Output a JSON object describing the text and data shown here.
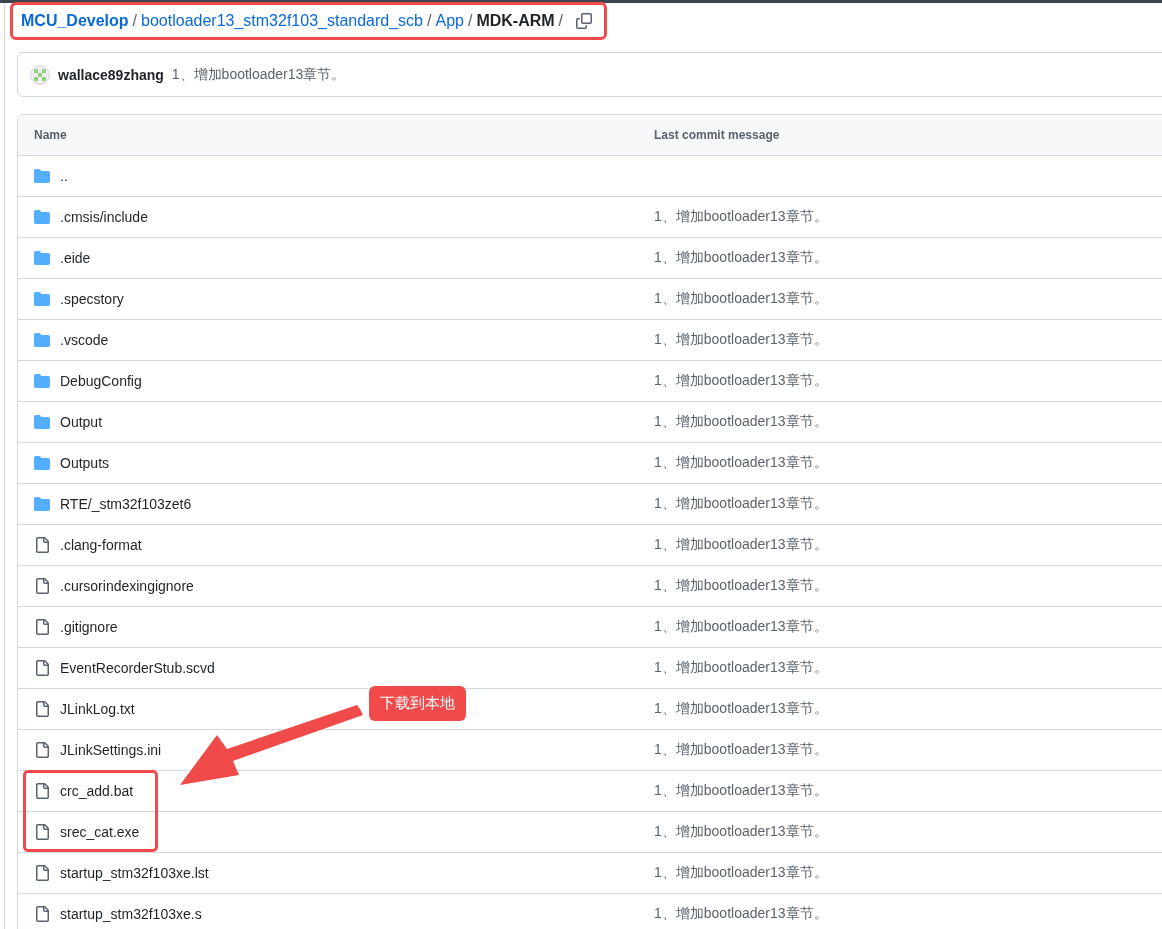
{
  "breadcrumb": {
    "marked": true,
    "items": [
      {
        "label": "MCU_Develop",
        "kind": "repo"
      },
      {
        "label": "/",
        "kind": "sep"
      },
      {
        "label": "bootloader13_stm32f103_standard_scb",
        "kind": "link"
      },
      {
        "label": "/",
        "kind": "sep"
      },
      {
        "label": "App",
        "kind": "link"
      },
      {
        "label": "/",
        "kind": "sep"
      },
      {
        "label": "MDK-ARM",
        "kind": "current"
      },
      {
        "label": "/",
        "kind": "sep"
      }
    ]
  },
  "latest_commit": {
    "author": "wallace89zhang",
    "message": "1、增加bootloader13章节。"
  },
  "table": {
    "columns": [
      "Name",
      "Last commit message"
    ],
    "rows": [
      {
        "name": "..",
        "kind": "folder",
        "message": "",
        "marked": false
      },
      {
        "name": ".cmsis/include",
        "kind": "folder",
        "message": "1、增加bootloader13章节。",
        "marked": false
      },
      {
        "name": ".eide",
        "kind": "folder",
        "message": "1、增加bootloader13章节。",
        "marked": false
      },
      {
        "name": ".specstory",
        "kind": "folder",
        "message": "1、增加bootloader13章节。",
        "marked": false
      },
      {
        "name": ".vscode",
        "kind": "folder",
        "message": "1、增加bootloader13章节。",
        "marked": false
      },
      {
        "name": "DebugConfig",
        "kind": "folder",
        "message": "1、增加bootloader13章节。",
        "marked": false
      },
      {
        "name": "Output",
        "kind": "folder",
        "message": "1、增加bootloader13章节。",
        "marked": false
      },
      {
        "name": "Outputs",
        "kind": "folder",
        "message": "1、增加bootloader13章节。",
        "marked": false
      },
      {
        "name": "RTE/_stm32f103zet6",
        "kind": "folder",
        "message": "1、增加bootloader13章节。",
        "marked": false
      },
      {
        "name": ".clang-format",
        "kind": "file",
        "message": "1、增加bootloader13章节。",
        "marked": false
      },
      {
        "name": ".cursorindexingignore",
        "kind": "file",
        "message": "1、增加bootloader13章节。",
        "marked": false
      },
      {
        "name": ".gitignore",
        "kind": "file",
        "message": "1、增加bootloader13章节。",
        "marked": false
      },
      {
        "name": "EventRecorderStub.scvd",
        "kind": "file",
        "message": "1、增加bootloader13章节。",
        "marked": false
      },
      {
        "name": "JLinkLog.txt",
        "kind": "file",
        "message": "1、增加bootloader13章节。",
        "marked": false
      },
      {
        "name": "JLinkSettings.ini",
        "kind": "file",
        "message": "1、增加bootloader13章节。",
        "marked": false
      },
      {
        "name": "crc_add.bat",
        "kind": "file",
        "message": "1、增加bootloader13章节。",
        "marked": true
      },
      {
        "name": "srec_cat.exe",
        "kind": "file",
        "message": "1、增加bootloader13章节。",
        "marked": true
      },
      {
        "name": "startup_stm32f103xe.lst",
        "kind": "file",
        "message": "1、增加bootloader13章节。",
        "marked": false
      },
      {
        "name": "startup_stm32f103xe.s",
        "kind": "file",
        "message": "1、增加bootloader13章节。",
        "marked": false
      }
    ]
  },
  "callout": {
    "text": "下载到本地"
  }
}
